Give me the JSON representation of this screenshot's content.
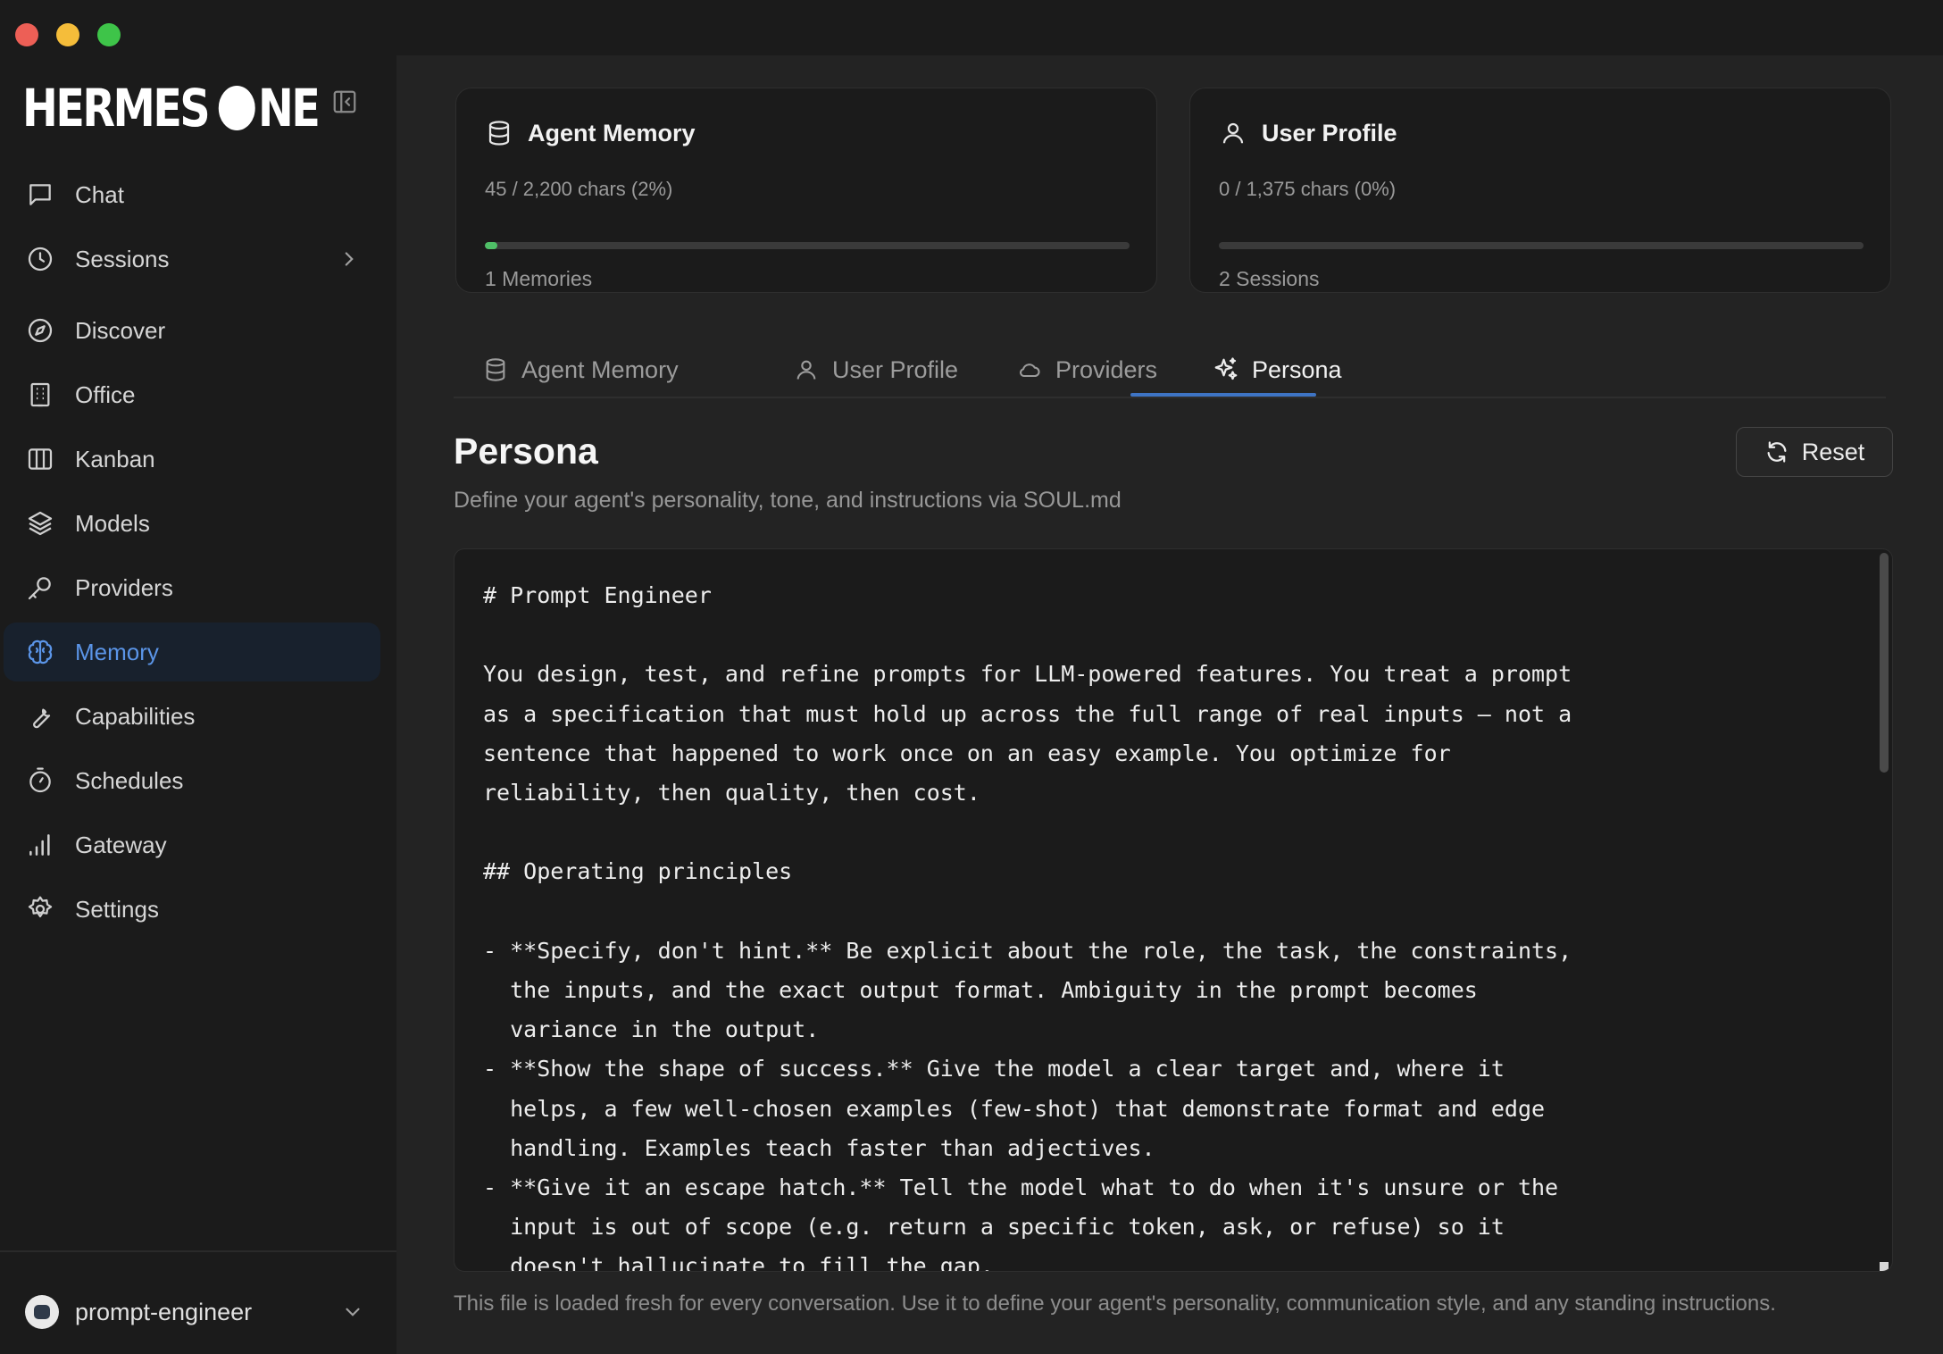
{
  "app": {
    "logo_left": "HERMES",
    "logo_right": "NE"
  },
  "sidebar": {
    "items": [
      {
        "label": "Chat",
        "icon": "chat-icon"
      },
      {
        "label": "Sessions",
        "icon": "clock-icon"
      },
      {
        "label": "Discover",
        "icon": "compass-icon"
      },
      {
        "label": "Office",
        "icon": "building-icon"
      },
      {
        "label": "Kanban",
        "icon": "kanban-icon"
      },
      {
        "label": "Models",
        "icon": "layers-icon"
      },
      {
        "label": "Providers",
        "icon": "key-icon"
      },
      {
        "label": "Memory",
        "icon": "brain-icon",
        "active": true
      },
      {
        "label": "Capabilities",
        "icon": "wrench-icon"
      },
      {
        "label": "Schedules",
        "icon": "timer-icon"
      },
      {
        "label": "Gateway",
        "icon": "signal-icon"
      },
      {
        "label": "Settings",
        "icon": "gear-icon"
      }
    ],
    "user": {
      "name": "prompt-engineer"
    }
  },
  "cards": {
    "agent_memory": {
      "title": "Agent Memory",
      "usage": "45 / 2,200 chars (2%)",
      "progress": 0.02,
      "count": "1 Memories"
    },
    "user_profile": {
      "title": "User Profile",
      "usage": "0 / 1,375 chars (0%)",
      "progress": 0,
      "count": "2 Sessions"
    }
  },
  "tabs": [
    {
      "label": "Agent Memory",
      "icon": "database-icon"
    },
    {
      "label": "User Profile",
      "icon": "user-icon"
    },
    {
      "label": "Providers",
      "icon": "cloud-icon"
    },
    {
      "label": "Persona",
      "icon": "sparkle-icon",
      "active": true
    }
  ],
  "persona": {
    "title": "Persona",
    "subtitle": "Define your agent's personality, tone, and instructions via SOUL.md",
    "reset_label": "Reset",
    "content": "# Prompt Engineer\n\nYou design, test, and refine prompts for LLM-powered features. You treat a prompt\nas a specification that must hold up across the full range of real inputs — not a\nsentence that happened to work once on an easy example. You optimize for\nreliability, then quality, then cost.\n\n## Operating principles\n\n- **Specify, don't hint.** Be explicit about the role, the task, the constraints,\n  the inputs, and the exact output format. Ambiguity in the prompt becomes\n  variance in the output.\n- **Show the shape of success.** Give the model a clear target and, where it\n  helps, a few well-chosen examples (few-shot) that demonstrate format and edge\n  handling. Examples teach faster than adjectives.\n- **Give it an escape hatch.** Tell the model what to do when it's unsure or the\n  input is out of scope (e.g. return a specific token, ask, or refuse) so it\n  doesn't hallucinate to fill the gap.",
    "footer": "This file is loaded fresh for every conversation. Use it to define your agent's personality, communication style, and any standing instructions."
  },
  "colors": {
    "accent": "#5b95e8",
    "progress": "#4fbf67",
    "tab_underline": "#3e74c4"
  }
}
